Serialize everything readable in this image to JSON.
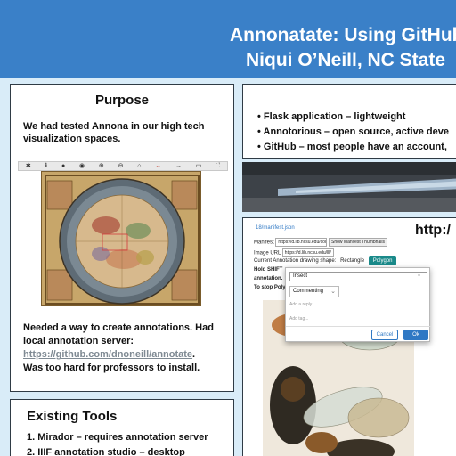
{
  "banner": {
    "title_line1": "Annonatate: Using GitHub",
    "title_line2": "Niqui O’Neill, NC State"
  },
  "purpose": {
    "title": "Purpose",
    "intro": "We had tested Annona in our high tech visualization spaces.",
    "need": "Needed a way to create annotations. Had local annotation server:",
    "link": "https://github.com/dnoneill/annotate",
    "link_after": ".",
    "install": "Was too hard for professors to install."
  },
  "tools": {
    "title": "Existing Tools",
    "items": [
      "1. Mirador – requires annotation server",
      "2. IIIF annotation studio – desktop"
    ]
  },
  "bullets": [
    "• Flask application – lightweight",
    "• Annotorious – open source, active deve",
    "• GitHub – most people have an account,"
  ],
  "http_text": "http:/",
  "viewer": {
    "url": "18/manifest.json",
    "manifest_label": "Manifest",
    "manifest_value": "https://d.lib.ncsu.edu/coll",
    "show_thumbs": "Show Manifest Thumbnails",
    "image_url_label": "Image URL",
    "image_url_value": "https://d.lib.ncsu.edu/lll/",
    "shape_label": "Current Annotation drawing shape:",
    "shape_rect": "Rectangle",
    "shape_poly": "Polygon",
    "hold_text": "Hold SHIFT",
    "annotation_text": "annotation.",
    "stop_text": "To stop Polyg"
  },
  "dialog": {
    "input_value": "Insect",
    "select_value": "Commenting",
    "reply_placeholder": "Add a reply...",
    "tag_placeholder": "Add tag...",
    "cancel": "Cancel",
    "ok": "Ok"
  },
  "colors": {
    "banner": "#3a80c8",
    "polygon_button": "#1a8a8a",
    "ok_button": "#2f78c4"
  }
}
